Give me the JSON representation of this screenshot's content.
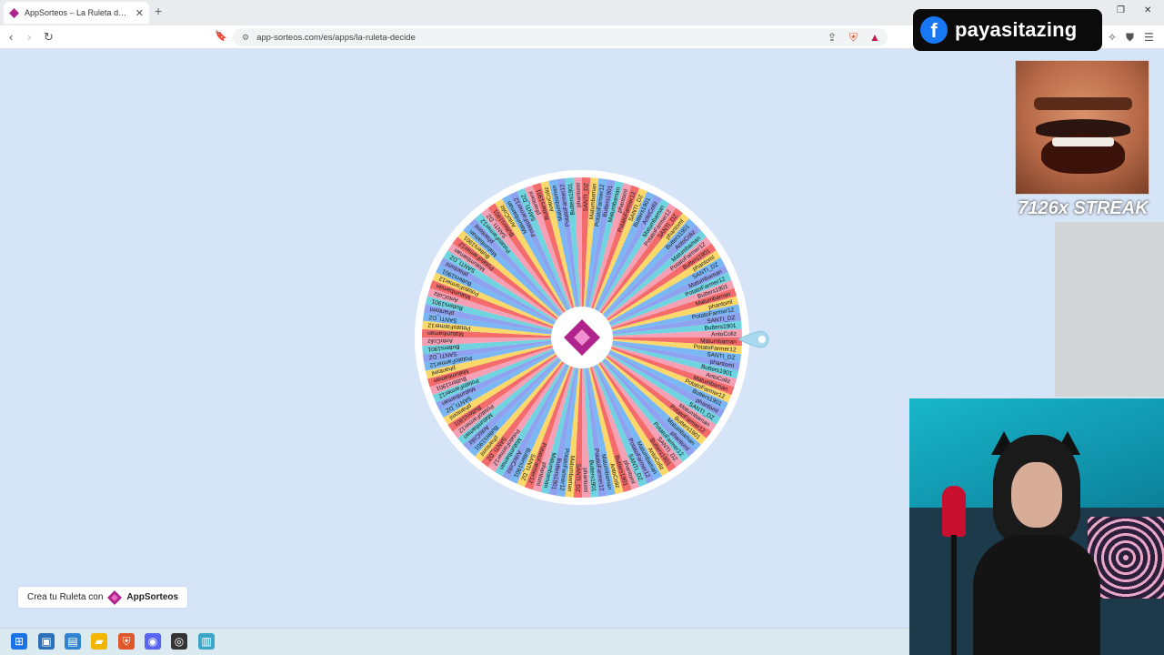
{
  "browser": {
    "tab_title": "AppSorteos – La Ruleta de la Su",
    "new_tab": "+",
    "url": "app-sorteos.com/es/apps/la-ruleta-decide"
  },
  "overlay": {
    "facebook_name": "payasitazing",
    "streak": "7126x STREAK"
  },
  "wheel": {
    "names": [
      "Matumbaman",
      "PotatoFarmer12",
      "SANTI_DZ",
      "phantoml",
      "Butters1901",
      "AntoColiz",
      "Matumbaman",
      "PotatoFarmer12",
      "Butters1901",
      "phantoml",
      "SANTI_DZ",
      "Matumbaman",
      "PotatoFarmer12",
      "Butters1901",
      "Matumbaman",
      "phantoml",
      "PotatoFarmer12",
      "SANTI_DZ",
      "Butters1901",
      "AntoColiz"
    ],
    "colors": [
      "#f36b6b",
      "#fbd86a",
      "#7ab8f5",
      "#8fa2f0",
      "#6fd3e0",
      "#f5a0b5"
    ]
  },
  "brand": {
    "cta": "Crea tu Ruleta con",
    "name": "AppSorteos"
  }
}
